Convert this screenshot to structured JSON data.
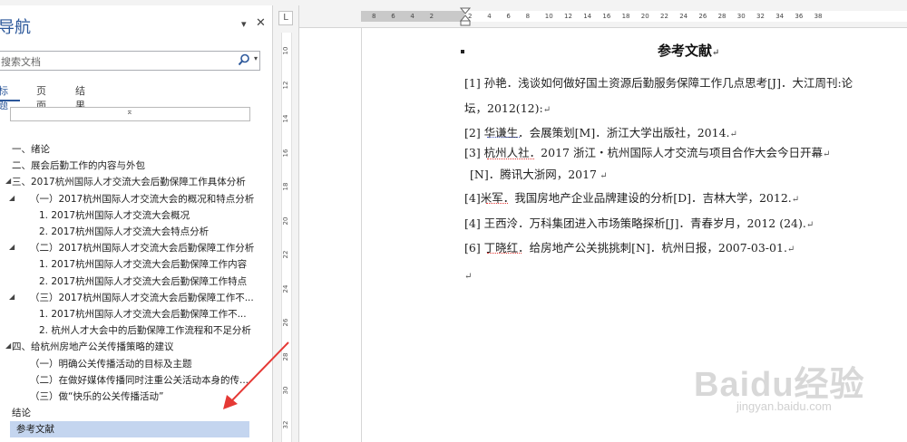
{
  "nav": {
    "title": "导航",
    "search_placeholder": "搜索文档",
    "tabs": [
      "标题",
      "页面",
      "结果"
    ],
    "items": [
      {
        "label": "一、绪论",
        "level": 0,
        "toggle": ""
      },
      {
        "label": "二、展会后勤工作的内容与外包",
        "level": 0,
        "toggle": ""
      },
      {
        "label": "三、2017杭州国际人才交流大会后勤保障工作具体分析",
        "level": 0,
        "toggle": "◢"
      },
      {
        "label": "（一）2017杭州国际人才交流大会的概况和特点分析",
        "level": 1,
        "toggle": "◢"
      },
      {
        "label": "1. 2017杭州国际人才交流大会概况",
        "level": 2,
        "toggle": ""
      },
      {
        "label": "2. 2017杭州国际人才交流大会特点分析",
        "level": 2,
        "toggle": ""
      },
      {
        "label": "（二）2017杭州国际人才交流大会后勤保障工作分析",
        "level": 1,
        "toggle": "◢"
      },
      {
        "label": "1. 2017杭州国际人才交流大会后勤保障工作内容",
        "level": 2,
        "toggle": ""
      },
      {
        "label": "2. 2017杭州国际人才交流大会后勤保障工作特点",
        "level": 2,
        "toggle": ""
      },
      {
        "label": "（三）2017杭州国际人才交流大会后勤保障工作不...",
        "level": 1,
        "toggle": "◢"
      },
      {
        "label": "1. 2017杭州国际人才交流大会后勤保障工作不...",
        "level": 2,
        "toggle": ""
      },
      {
        "label": "2. 杭州人才大会中的后勤保障工作流程和不足分析",
        "level": 2,
        "toggle": ""
      },
      {
        "label": "四、给杭州房地产公关传播策略的建议",
        "level": 0,
        "toggle": "◢"
      },
      {
        "label": "（一）明确公关传播活动的目标及主题",
        "level": 1,
        "toggle": ""
      },
      {
        "label": "（二）在做好媒体传播同时注重公关活动本身的传...",
        "level": 1,
        "toggle": ""
      },
      {
        "label": "（三）做“快乐的公关传播活动”",
        "level": 1,
        "toggle": ""
      },
      {
        "label": "结论",
        "level": 0,
        "toggle": ""
      },
      {
        "label": "参考文献",
        "level": 0,
        "toggle": "",
        "selected": true
      }
    ]
  },
  "ruler": {
    "h_labels": [
      "8",
      "6",
      "4",
      "2",
      "",
      "2",
      "4",
      "6",
      "8",
      "10",
      "12",
      "14",
      "16",
      "18",
      "20",
      "22",
      "24",
      "26",
      "28",
      "30",
      "32",
      "34",
      "36",
      "38"
    ],
    "v_labels": [
      "10",
      "12",
      "14",
      "16",
      "18",
      "20",
      "22",
      "24",
      "26",
      "28",
      "30",
      "32"
    ],
    "tab_selector": "L"
  },
  "document": {
    "heading": "参考文献",
    "references": [
      {
        "line1": "[1] 孙艳．浅谈如何做好国土资源后勤服务保障工作几点思考[J]．大江周刊:论",
        "line2": "坛，2012(12):"
      },
      {
        "line1": "[2] 华谦生．会展策划[M]．浙江大学出版社，2014."
      },
      {
        "line1": "[3] 杭州人社．2017 浙江・杭州国际人才交流与项目合作大会今日开幕",
        "line2": "[N]．腾讯大浙网，2017"
      },
      {
        "line1": "[4]米军．我国房地产企业品牌建设的分析[D]．吉林大学，2012."
      },
      {
        "line1": "[4] 王西泠．万科集团进入市场策略探析[J]．青春岁月，2012 (24)."
      },
      {
        "line1": "[6] 丁晓红．给房地产公关挑挑刺[N]．杭州日报，2007-03-01."
      }
    ]
  },
  "watermark": {
    "brand": "Baidu经验",
    "url": "jingyan.baidu.com"
  },
  "colors": {
    "accent": "#2b579a",
    "selected_bg": "#c4d5ef",
    "arrow": "#e53935"
  }
}
